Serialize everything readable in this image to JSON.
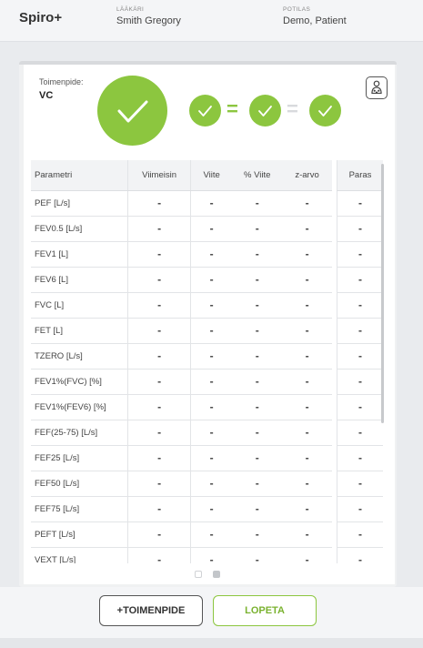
{
  "header": {
    "app_title": "Spiro+",
    "doctor_label": "LÄÄKÄRI",
    "doctor_name": "Smith Gregory",
    "patient_label": "POTILAS",
    "patient_name": "Demo, Patient"
  },
  "procedure": {
    "label": "Toimenpide:",
    "value": "VC"
  },
  "icons": {
    "big_check": "checkmark-icon",
    "small_checks": [
      "checkmark-icon",
      "checkmark-icon",
      "checkmark-icon"
    ],
    "equals_1": "=",
    "equals_2": "=",
    "side_button": "person-icon"
  },
  "colors": {
    "accent_green": "#8cc63f",
    "inactive_gray": "#d8dadd"
  },
  "table": {
    "columns": {
      "param": "Parametri",
      "last": "Viimeisin",
      "ref": "Viite",
      "pct": "% Viite",
      "z": "z-arvo",
      "best": "Paras"
    },
    "rows": [
      {
        "param": "PEF [L/s]",
        "last": "-",
        "ref": "-",
        "pct": "-",
        "z": "-",
        "best": "-"
      },
      {
        "param": "FEV0.5 [L/s]",
        "last": "-",
        "ref": "-",
        "pct": "-",
        "z": "-",
        "best": "-"
      },
      {
        "param": "FEV1 [L]",
        "last": "-",
        "ref": "-",
        "pct": "-",
        "z": "-",
        "best": "-"
      },
      {
        "param": "FEV6 [L]",
        "last": "-",
        "ref": "-",
        "pct": "-",
        "z": "-",
        "best": "-"
      },
      {
        "param": "FVC [L]",
        "last": "-",
        "ref": "-",
        "pct": "-",
        "z": "-",
        "best": "-"
      },
      {
        "param": "FET [L]",
        "last": "-",
        "ref": "-",
        "pct": "-",
        "z": "-",
        "best": "-"
      },
      {
        "param": "TZERO [L/s]",
        "last": "-",
        "ref": "-",
        "pct": "-",
        "z": "-",
        "best": "-"
      },
      {
        "param": "FEV1%(FVC) [%]",
        "last": "-",
        "ref": "-",
        "pct": "-",
        "z": "-",
        "best": "-"
      },
      {
        "param": "FEV1%(FEV6) [%]",
        "last": "-",
        "ref": "-",
        "pct": "-",
        "z": "-",
        "best": "-"
      },
      {
        "param": "FEF(25-75) [L/s]",
        "last": "-",
        "ref": "-",
        "pct": "-",
        "z": "-",
        "best": "-"
      },
      {
        "param": "FEF25 [L/s]",
        "last": "-",
        "ref": "-",
        "pct": "-",
        "z": "-",
        "best": "-"
      },
      {
        "param": "FEF50 [L/s]",
        "last": "-",
        "ref": "-",
        "pct": "-",
        "z": "-",
        "best": "-"
      },
      {
        "param": "FEF75 [L/s]",
        "last": "-",
        "ref": "-",
        "pct": "-",
        "z": "-",
        "best": "-"
      },
      {
        "param": "PEFT [L/s]",
        "last": "-",
        "ref": "-",
        "pct": "-",
        "z": "-",
        "best": "-"
      },
      {
        "param": "VEXT [L/s]",
        "last": "-",
        "ref": "-",
        "pct": "-",
        "z": "-",
        "best": "-"
      }
    ]
  },
  "pager": {
    "pages": 2,
    "current": 2
  },
  "buttons": {
    "add_procedure": "+TOIMENPIDE",
    "finish": "LOPETA"
  }
}
